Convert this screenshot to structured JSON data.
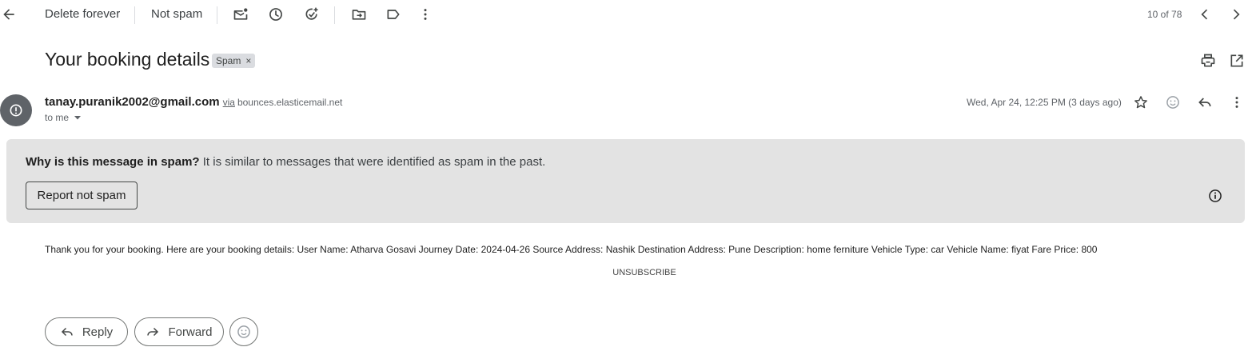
{
  "toolbar": {
    "back_icon": "arrow-left-icon",
    "delete_forever_label": "Delete forever",
    "not_spam_label": "Not spam",
    "mark_unread_icon": "mark-unread-icon",
    "snooze_icon": "clock-icon",
    "add_task_icon": "add-task-icon",
    "move_to_icon": "move-to-folder-icon",
    "label_icon": "label-icon",
    "more_icon": "more-vertical-icon",
    "counter": "10 of 78",
    "prev_icon": "chevron-left-icon",
    "next_icon": "chevron-right-icon"
  },
  "subject": {
    "title": "Your booking details",
    "badge": "Spam",
    "badge_close": "×",
    "print_icon": "print-icon",
    "open_new_window_icon": "open-in-new-icon"
  },
  "message": {
    "sender_email": "tanay.puranik2002@gmail.com",
    "via_label": "via",
    "via_domain": "bounces.elasticemail.net",
    "to_label": "to me",
    "date": "Wed, Apr 24, 12:25 PM (3 days ago)",
    "star_icon": "star-icon",
    "emoji_icon": "emoji-icon",
    "reply_icon": "reply-icon",
    "more_icon": "more-vertical-icon"
  },
  "spam_warning": {
    "question": "Why is this message in spam?",
    "explanation": "It is similar to messages that were identified as spam in the past.",
    "report_button": "Report not spam",
    "info_icon": "info-icon"
  },
  "body": {
    "text": "Thank you for your booking. Here are your booking details: User Name: Atharva Gosavi Journey Date: 2024-04-26 Source Address: Nashik Destination Address: Pune Description: home ferniture Vehicle Type: car Vehicle Name: fiyat Fare Price: 800",
    "unsubscribe": "UNSUBSCRIBE"
  },
  "actions": {
    "reply_label": "Reply",
    "forward_label": "Forward"
  },
  "colors": {
    "warning_bg": "#e3e3e3",
    "avatar_bg": "#5f6368",
    "badge_bg": "#dadce0"
  }
}
